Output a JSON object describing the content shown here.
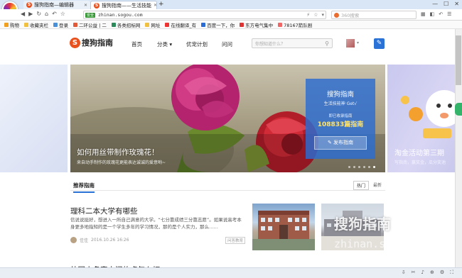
{
  "browser": {
    "tabs": [
      {
        "label": "搜狗指南—编辑器"
      },
      {
        "label": "搜狗指南——生活技能"
      }
    ],
    "new_tab": "+",
    "url": "zhinan.sogou.com",
    "secure_label": "安全",
    "search_placeholder": "360搜索",
    "window_controls": [
      "—",
      "☐",
      "✕"
    ]
  },
  "bookmarks": [
    {
      "label": "购物",
      "color": "#f0a020"
    },
    {
      "label": "收藏夹栏",
      "color": "#f0c040"
    },
    {
      "label": "登录",
      "color": "#4a90d9"
    },
    {
      "label": "二环公益 | 二",
      "color": "#e35a3a"
    },
    {
      "label": "各类招标网",
      "color": "#2a8a5a"
    },
    {
      "label": "网址",
      "color": "#f0c040"
    },
    {
      "label": "在线翻译_有",
      "color": "#e33"
    },
    {
      "label": "百度一下，你",
      "color": "#2a6bd6"
    },
    {
      "label": "东方电气集中",
      "color": "#d33"
    },
    {
      "label": "78167箭队剧",
      "color": "#e66"
    }
  ],
  "site": {
    "brand": "搜狗指南",
    "brand_logo_letter": "S",
    "nav": [
      "首页",
      "分类",
      "优宠计划",
      "问问"
    ],
    "search_placeholder": "你想知道什么？"
  },
  "hero": {
    "title": "如何用丝带制作玫瑰花！",
    "subtitle": "来自动手制作的玫瑰花更能表达诚诚的爱意哟~",
    "slides_total": 6,
    "slide_active_index": 5
  },
  "card": {
    "title": "搜狗指南",
    "tagline": "生活技能神 Get√",
    "count_label": "即已收录指南",
    "count": "108833篇指南",
    "button": "发布指南"
  },
  "side_banner": {
    "title": "淘金活动第三期",
    "subtitle": "写指南，赢奖金，瓜分奖池"
  },
  "feed": {
    "tab_recommend": "推荐指南",
    "sort_hot": "热门",
    "sort_new": "最新",
    "articles": [
      {
        "title": "理科二本大学有哪些",
        "body": "信说说挺好，想进入一所自己满意的大学。“七分靠成绩三分靠志愿”。如果说高考本身更多地指知的是一个学生多年的学习情况，那的是个人实力，那么……",
        "author": "佳佳",
        "time": "2016.10.26 16:26",
        "tag": "问答教育"
      },
      {
        "title": "外国人名字中间的点怎么打"
      }
    ]
  },
  "watermark": {
    "brand": "搜狗指南",
    "url": "zhinan.sogou.com"
  }
}
